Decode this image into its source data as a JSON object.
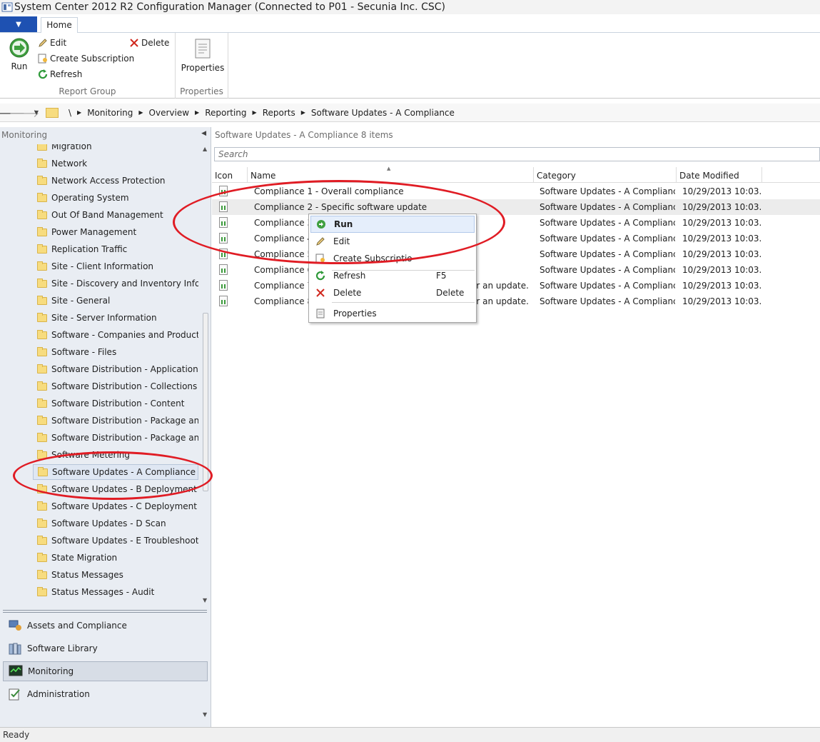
{
  "window": {
    "title": "System Center 2012 R2 Configuration Manager (Connected to P01 - Secunia Inc. CSC)"
  },
  "ribbon": {
    "tab_home": "Home",
    "run_label": "Run",
    "edit_label": "Edit",
    "create_subscription_label": "Create Subscription",
    "refresh_label": "Refresh",
    "delete_label": "Delete",
    "properties_label": "Properties",
    "group_report": "Report Group",
    "group_properties": "Properties"
  },
  "address": {
    "root": "\\",
    "crumbs": [
      "Monitoring",
      "Overview",
      "Reporting",
      "Reports",
      "Software Updates - A Compliance"
    ]
  },
  "left": {
    "header": "Monitoring",
    "tree": [
      "Migration",
      "Network",
      "Network Access Protection",
      "Operating System",
      "Out Of Band Management",
      "Power Management",
      "Replication Traffic",
      "Site - Client Information",
      "Site - Discovery and Inventory Informat",
      "Site - General",
      "Site - Server Information",
      "Software - Companies and Products",
      "Software - Files",
      "Software Distribution - Application Mo",
      "Software Distribution - Collections",
      "Software Distribution - Content",
      "Software Distribution - Package and Pr",
      "Software Distribution - Package and Pr",
      "Software Metering",
      "Software Updates - A Compliance",
      "Software Updates - B Deployment Mar",
      "Software Updates - C Deployment Stat",
      "Software Updates - D Scan",
      "Software Updates - E Troubleshooting",
      "State Migration",
      "Status Messages",
      "Status Messages - Audit"
    ],
    "selected_index": 19,
    "workspaces": [
      "Assets and Compliance",
      "Software Library",
      "Monitoring",
      "Administration"
    ],
    "active_workspace": "Monitoring"
  },
  "main": {
    "header_title": "Software Updates - A Compliance",
    "header_count": "8 items",
    "search_placeholder": "Search",
    "columns": {
      "icon": "Icon",
      "name": "Name",
      "category": "Category",
      "date": "Date Modified"
    },
    "rows": [
      {
        "name": "Compliance 1 - Overall compliance",
        "tail": "",
        "category": "Software Updates - A Compliance",
        "date": "10/29/2013 10:03..."
      },
      {
        "name": "Compliance 2 - Specific software update",
        "tail": "",
        "category": "Software Updates - A Compliance",
        "date": "10/29/2013 10:03..."
      },
      {
        "name": "Compliance 3",
        "tail": "",
        "category": "Software Updates - A Compliance",
        "date": "10/29/2013 10:03..."
      },
      {
        "name": "Compliance 4",
        "tail": "",
        "category": "Software Updates - A Compliance",
        "date": "10/29/2013 10:03..."
      },
      {
        "name": "Compliance 5",
        "tail": "",
        "category": "Software Updates - A Compliance",
        "date": "10/29/2013 10:03..."
      },
      {
        "name": "Compliance 6",
        "tail": "",
        "category": "Software Updates - A Compliance",
        "date": "10/29/2013 10:03..."
      },
      {
        "name": "Compliance 7",
        "tail": "or an update...",
        "category": "Software Updates - A Compliance",
        "date": "10/29/2013 10:03..."
      },
      {
        "name": "Compliance 8",
        "tail": "or an update...",
        "category": "Software Updates - A Compliance",
        "date": "10/29/2013 10:03..."
      }
    ]
  },
  "context_menu": {
    "run": "Run",
    "edit": "Edit",
    "create_subscription": "Create Subscriptio",
    "refresh": "Refresh",
    "refresh_shortcut": "F5",
    "delete": "Delete",
    "delete_shortcut": "Delete",
    "properties": "Properties"
  },
  "status": {
    "text": "Ready"
  },
  "colors": {
    "accent": "#1e51b2",
    "annotation": "#e01c24",
    "pane_bg": "#e9edf3"
  }
}
